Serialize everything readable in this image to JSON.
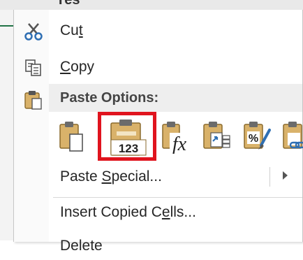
{
  "sheet": {
    "partial_text": "Yes"
  },
  "menu": {
    "cut": {
      "label": "Cut",
      "icon": "scissors-icon"
    },
    "copy": {
      "label": "Copy",
      "icon": "copy-icon"
    },
    "paste_options": {
      "header": "Paste Options:",
      "icon": "clipboard-icon",
      "buttons": [
        {
          "name": "paste-button",
          "icon": "paste-icon"
        },
        {
          "name": "paste-values-button",
          "icon": "paste-values-icon",
          "text": "123",
          "selected": true
        },
        {
          "name": "paste-formulas-button",
          "icon": "paste-formulas-icon",
          "text": "fx"
        },
        {
          "name": "paste-transpose-button",
          "icon": "paste-transpose-icon"
        },
        {
          "name": "paste-formatting-button",
          "icon": "paste-formatting-icon",
          "text": "%"
        },
        {
          "name": "paste-link-button",
          "icon": "paste-link-icon"
        }
      ]
    },
    "paste_special": {
      "label": "Paste Special...",
      "underline": "S"
    },
    "insert_copied_cells": {
      "label": "Insert Copied Cells..."
    },
    "delete": {
      "label": "Delete"
    }
  },
  "colors": {
    "selection_border": "#e0141e",
    "clipboard_tan": "#d9b26a",
    "clipboard_dark": "#6b6b6b",
    "accent_blue": "#2f6fb3"
  }
}
